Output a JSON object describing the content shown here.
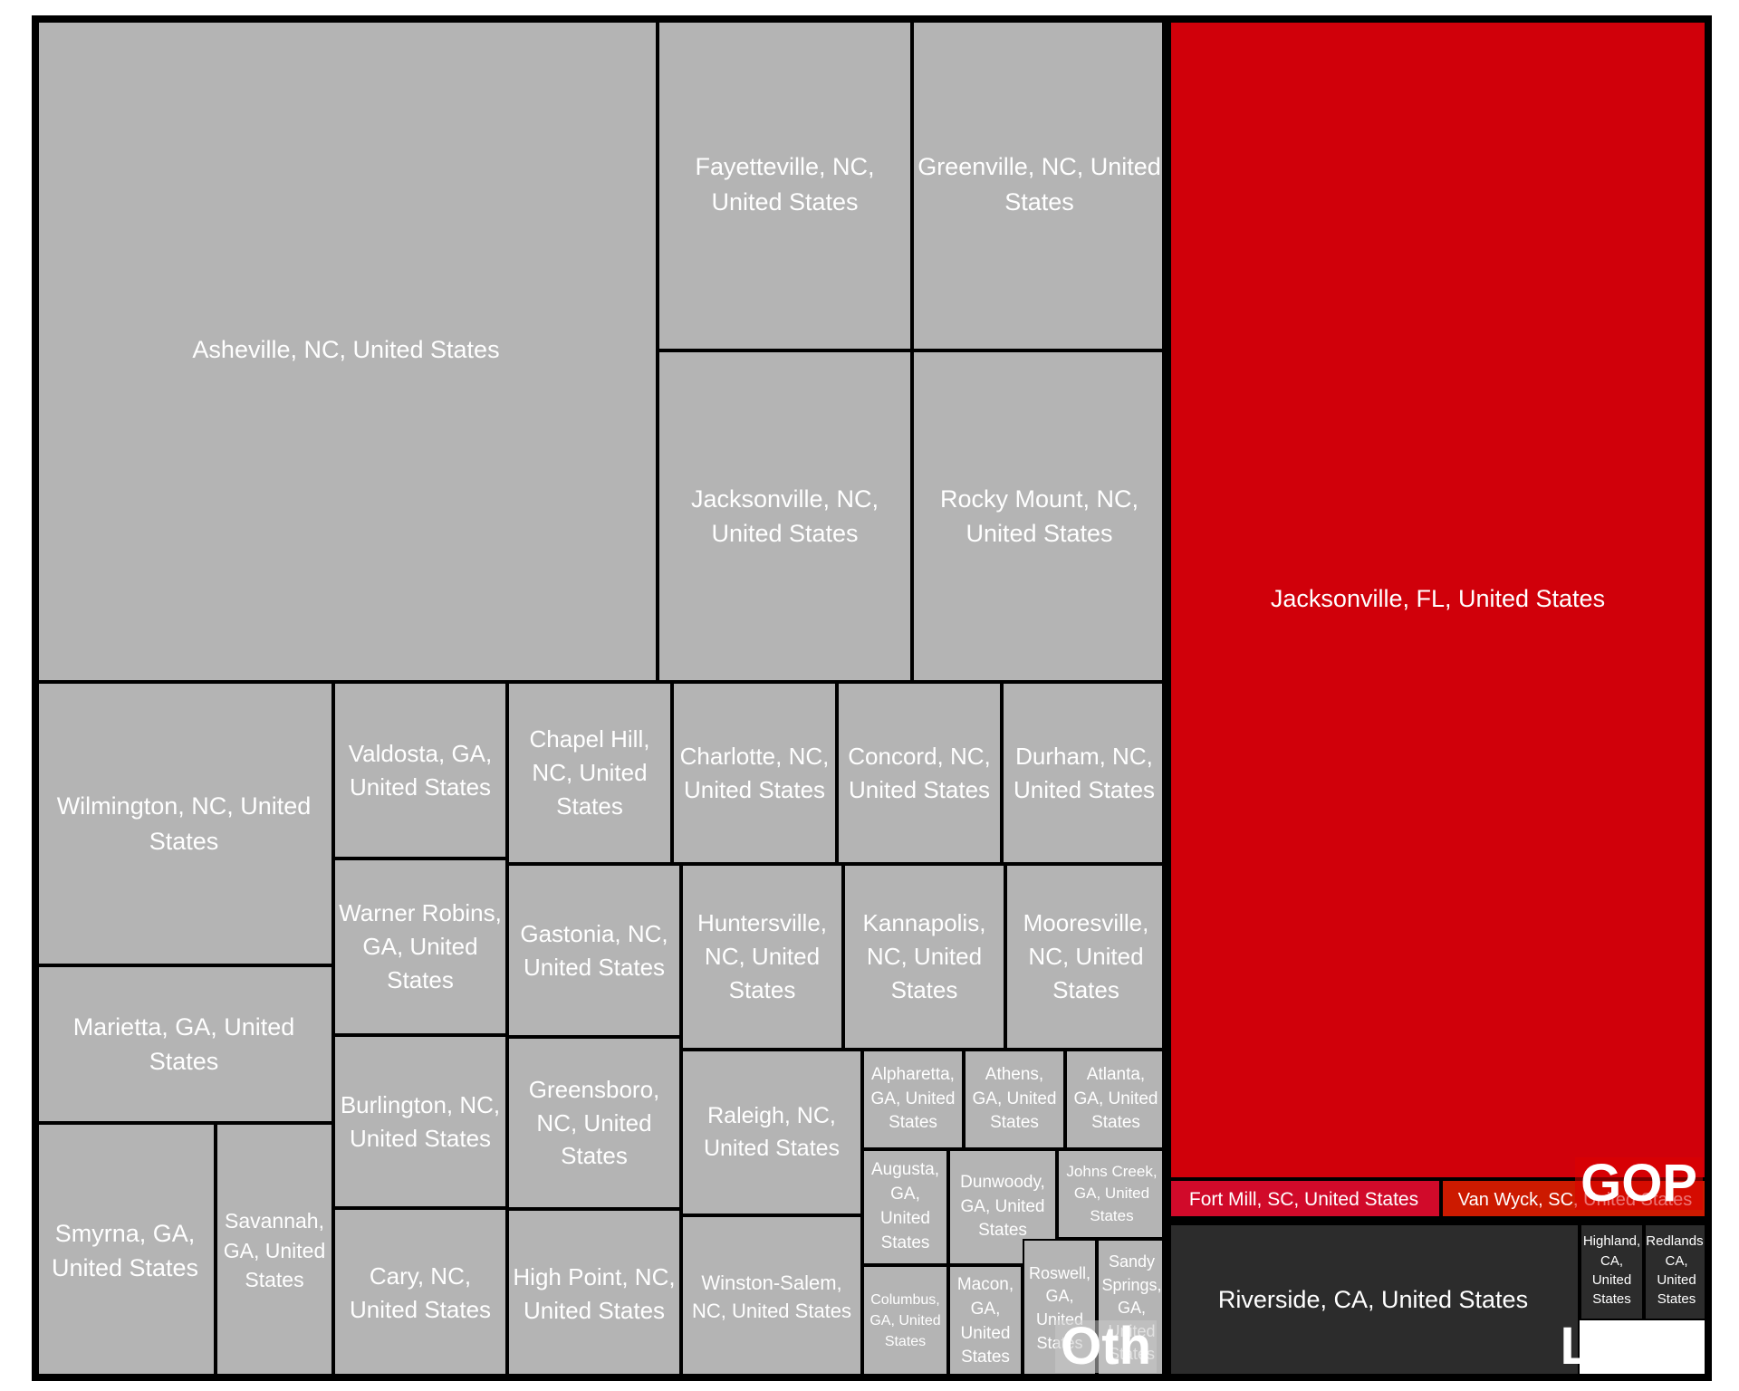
{
  "chart_data": {
    "type": "treemap",
    "colors": {
      "GOP": "#d0000a",
      "Oth": "#b4b4b4",
      "Local": "#2c2c2c",
      "fort_mill": "#d10a2a",
      "van_wyck": "#cc1a00"
    },
    "groups": [
      {
        "name": "Oth",
        "label": "Oth",
        "items": [
          {
            "label": "Asheville, NC, United States"
          },
          {
            "label": "Fayetteville, NC, United States"
          },
          {
            "label": "Greenville, NC, United States"
          },
          {
            "label": "Jacksonville, NC, United States"
          },
          {
            "label": "Rocky Mount, NC, United States"
          },
          {
            "label": "Wilmington, NC, United States"
          },
          {
            "label": "Marietta, GA, United States"
          },
          {
            "label": "Smyrna, GA, United States"
          },
          {
            "label": "Savannah, GA, United States"
          },
          {
            "label": "Valdosta, GA, United States"
          },
          {
            "label": "Warner Robins, GA, United States"
          },
          {
            "label": "Burlington, NC, United States"
          },
          {
            "label": "Cary, NC, United States"
          },
          {
            "label": "Chapel Hill, NC, United States"
          },
          {
            "label": "Charlotte, NC, United States"
          },
          {
            "label": "Concord, NC, United States"
          },
          {
            "label": "Durham, NC, United States"
          },
          {
            "label": "Gastonia, NC, United States"
          },
          {
            "label": "Greensboro, NC, United States"
          },
          {
            "label": "High Point, NC, United States"
          },
          {
            "label": "Huntersville, NC, United States"
          },
          {
            "label": "Kannapolis, NC, United States"
          },
          {
            "label": "Mooresville, NC, United States"
          },
          {
            "label": "Raleigh, NC, United States"
          },
          {
            "label": "Winston-Salem, NC, United States"
          },
          {
            "label": "Alpharetta, GA, United States"
          },
          {
            "label": "Athens, GA, United States"
          },
          {
            "label": "Atlanta, GA, United States"
          },
          {
            "label": "Augusta, GA, United States"
          },
          {
            "label": "Dunwoody, GA, United States"
          },
          {
            "label": "Johns Creek, GA, United States"
          },
          {
            "label": "Columbus, GA, United States"
          },
          {
            "label": "Macon, GA, United States"
          },
          {
            "label": "Roswell, GA, United States"
          },
          {
            "label": "Sandy Springs, GA, United States"
          }
        ]
      },
      {
        "name": "GOP",
        "label": "GOP",
        "items": [
          {
            "label": "Jacksonville, FL, United States"
          },
          {
            "label": "Fort Mill, SC, United States"
          },
          {
            "label": "Van Wyck, SC, United States"
          }
        ]
      },
      {
        "name": "Local",
        "label": "Local",
        "items": [
          {
            "label": "Riverside, CA, United States"
          },
          {
            "label": "Highland, CA, United States"
          },
          {
            "label": "Redlands, CA, United States"
          }
        ]
      }
    ]
  }
}
